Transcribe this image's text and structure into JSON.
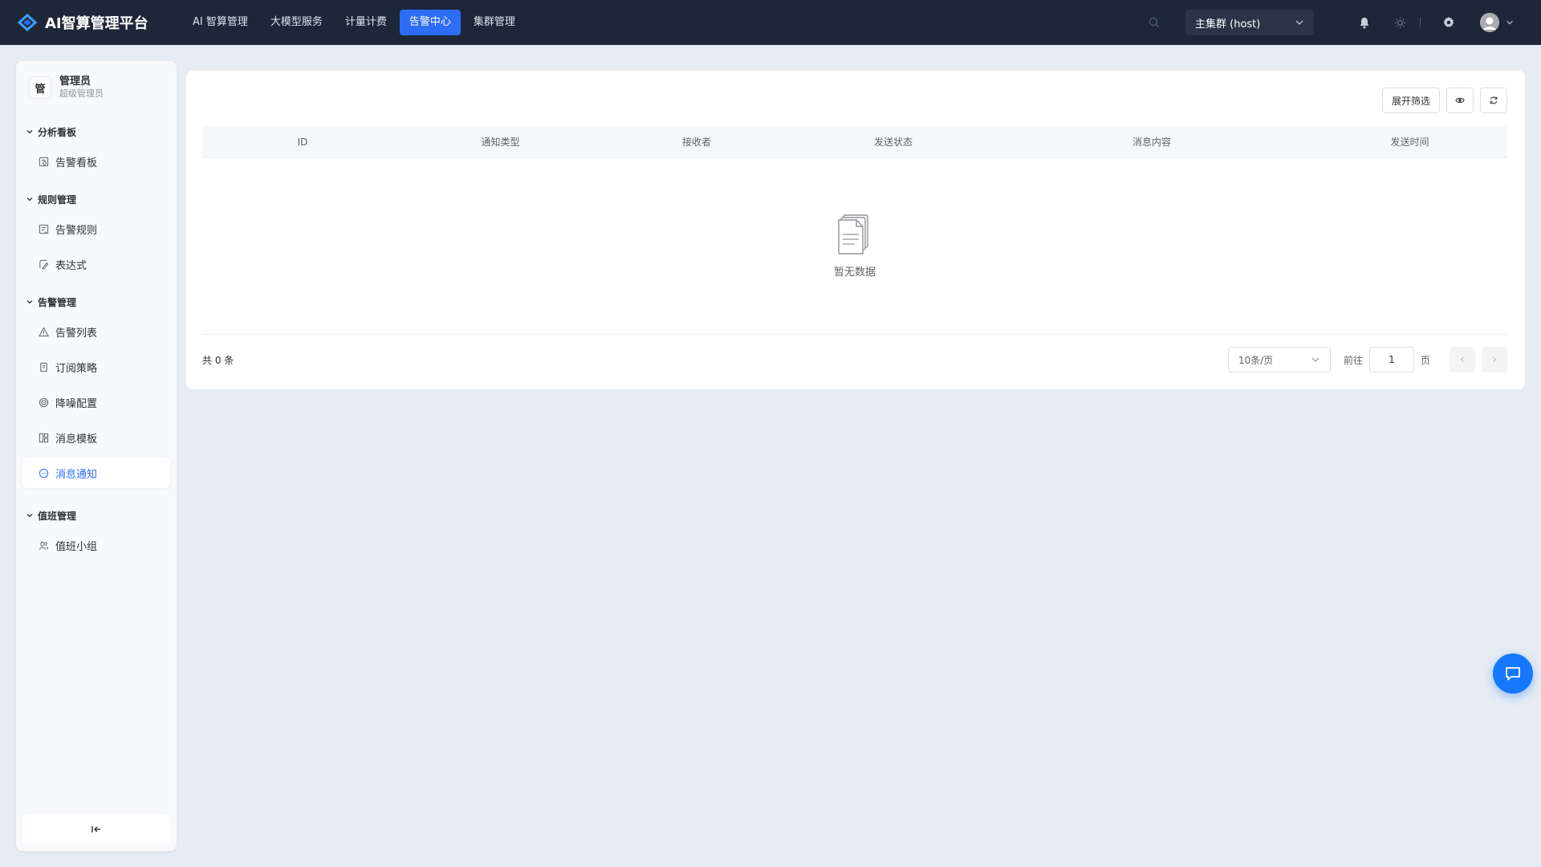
{
  "brand": {
    "title": "AI智算管理平台"
  },
  "nav": {
    "items": [
      {
        "label": "AI 智算管理"
      },
      {
        "label": "大模型服务"
      },
      {
        "label": "计量计费"
      },
      {
        "label": "告警中心"
      },
      {
        "label": "集群管理"
      }
    ],
    "active_index": 3
  },
  "header": {
    "cluster": "主集群 (host)"
  },
  "user": {
    "avatar_char": "管",
    "name": "管理员",
    "role": "超级管理员"
  },
  "sidebar": {
    "groups": [
      {
        "title": "分析看板",
        "items": [
          {
            "label": "告警看板",
            "icon": "dashboard-icon"
          }
        ]
      },
      {
        "title": "规则管理",
        "items": [
          {
            "label": "告警规则",
            "icon": "rule-icon"
          },
          {
            "label": "表达式",
            "icon": "expression-icon"
          }
        ]
      },
      {
        "title": "告警管理",
        "items": [
          {
            "label": "告警列表",
            "icon": "warning-icon"
          },
          {
            "label": "订阅策略",
            "icon": "subscribe-icon"
          },
          {
            "label": "降噪配置",
            "icon": "noise-icon"
          },
          {
            "label": "消息模板",
            "icon": "template-icon"
          },
          {
            "label": "消息通知",
            "icon": "message-icon"
          }
        ]
      },
      {
        "title": "值班管理",
        "items": [
          {
            "label": "值班小组",
            "icon": "team-icon"
          }
        ]
      }
    ],
    "active": "消息通知"
  },
  "toolbar": {
    "filter_label": "展开筛选"
  },
  "table": {
    "columns": [
      "ID",
      "通知类型",
      "接收者",
      "发送状态",
      "消息内容",
      "发送时间"
    ],
    "rows": [],
    "empty_text": "暂无数据"
  },
  "pagination": {
    "total_label": "共 0 条",
    "page_size": "10条/页",
    "goto_label": "前往",
    "current_page": "1",
    "page_unit": "页"
  },
  "colors": {
    "accent": "#2d6cf6",
    "topbar": "#1e2738",
    "background": "#e6ecf3",
    "fab": "#1677ff"
  }
}
